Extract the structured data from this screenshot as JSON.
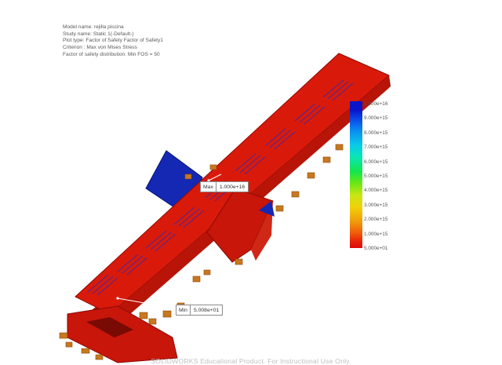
{
  "study_info": {
    "model_name": "Model name: rejilla piscina",
    "study_name": "Study name: Static 1(-Default-)",
    "plot_type": "Plot type: Factor of Safety Factor of Safety1",
    "criterion": "Criterion : Max von Mises Stress",
    "fos_distribution": "Factor of safety distribution: Min FOS = 50"
  },
  "legend": {
    "labels": [
      "1.000e+16",
      "9.000e+15",
      "8.000e+15",
      "7.000e+15",
      "6.000e+15",
      "5.000e+15",
      "4.000e+15",
      "3.000e+15",
      "2.000e+15",
      "1.000e+15",
      "5.000e+01"
    ],
    "top_color": "#0a14c8",
    "bottom_color": "#dc0a0a"
  },
  "max_callout": {
    "tag": "Max",
    "value": "1.000e+16"
  },
  "min_callout": {
    "tag": "Min",
    "value": "5.008e+01"
  },
  "colors": {
    "model_red": "#d91a0a",
    "model_dark_red": "#a00f05",
    "support_blue": "#1428b4",
    "hardware_orange": "#c8781e"
  },
  "watermark": "SOLIDWORKS Educational Product. For Instructional Use Only."
}
